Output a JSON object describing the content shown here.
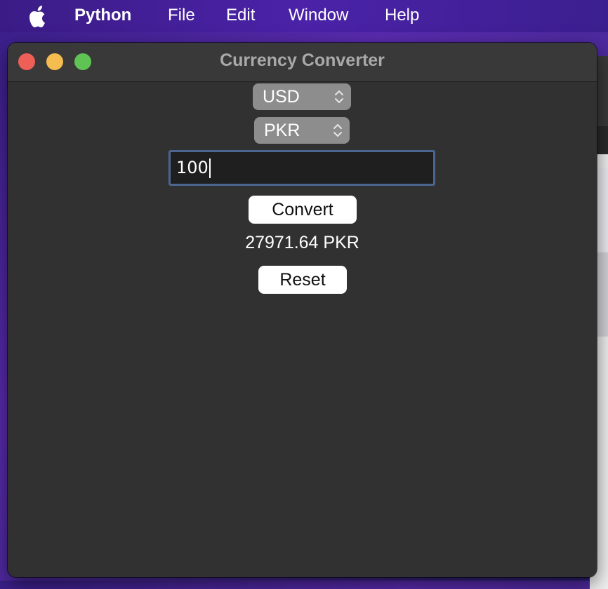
{
  "menubar": {
    "apple_icon": "apple-logo",
    "app_name": "Python",
    "items": [
      "File",
      "Edit",
      "Window",
      "Help"
    ]
  },
  "window": {
    "title": "Currency Converter",
    "controls": [
      "close",
      "minimize",
      "zoom"
    ]
  },
  "converter": {
    "from_currency": "USD",
    "to_currency": "PKR",
    "amount": "100",
    "convert_label": "Convert",
    "result": "27971.64 PKR",
    "reset_label": "Reset"
  },
  "colors": {
    "window_bg": "#313131",
    "select_bg": "#8d8d8d",
    "input_border": "#4b6791",
    "close": "#ee5f57",
    "minimize": "#f5bd4f",
    "zoom": "#60c454"
  }
}
